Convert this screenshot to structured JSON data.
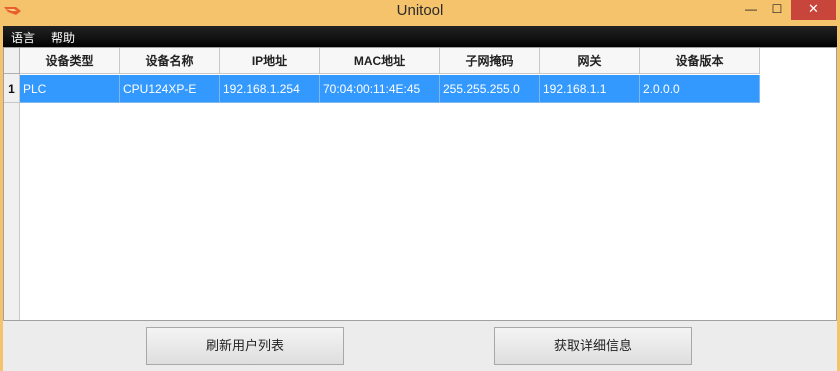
{
  "window": {
    "title": "Unitool",
    "minimize_label": "—",
    "maximize_label": "☐",
    "close_label": "✕"
  },
  "menu": {
    "items": [
      {
        "label": "语言"
      },
      {
        "label": "帮助"
      }
    ]
  },
  "table": {
    "columns": [
      "设备类型",
      "设备名称",
      "IP地址",
      "MAC地址",
      "子网掩码",
      "网关",
      "设备版本"
    ],
    "rows": [
      {
        "index": "1",
        "cells": [
          "PLC",
          "CPU124XP-E",
          "192.168.1.254",
          "70:04:00:11:4E:45",
          "255.255.255.0",
          "192.168.1.1",
          "2.0.0.0"
        ]
      }
    ]
  },
  "actions": {
    "refresh_label": "刷新用户列表",
    "details_label": "获取详细信息"
  },
  "colors": {
    "titlebar": "#f5c36b",
    "selection": "#3399ff",
    "close": "#c7453a"
  }
}
